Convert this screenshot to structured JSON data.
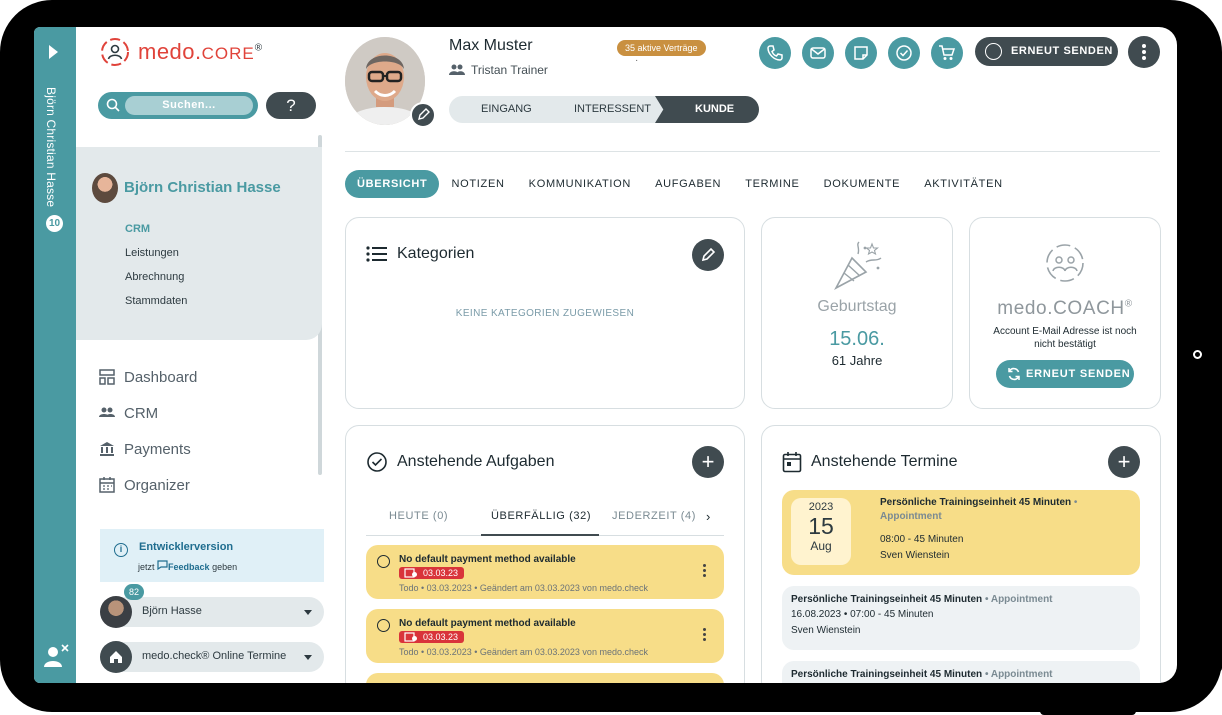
{
  "colors": {
    "accent": "#4a9aa2",
    "dark": "#404b50",
    "brand_red": "#e0433a",
    "warning": "#f7dd88",
    "danger": "#d9343a",
    "contracts": "#c99040"
  },
  "strip": {
    "client_name": "Björn Christian Hasse",
    "badge": "10"
  },
  "sidebar": {
    "logo_main": "medo.",
    "logo_suffix": "CORE",
    "logo_reg": "®",
    "search_placeholder": "Suchen...",
    "help_label": "?",
    "client": {
      "name": "Björn Christian Hasse",
      "menu": [
        "CRM",
        "Leistungen",
        "Abrechnung",
        "Stammdaten"
      ]
    },
    "nav": [
      {
        "label": "Dashboard",
        "icon": "dashboard-icon"
      },
      {
        "label": "CRM",
        "icon": "users-icon"
      },
      {
        "label": "Payments",
        "icon": "bank-icon"
      },
      {
        "label": "Organizer",
        "icon": "calendar-icon"
      }
    ],
    "dev_box": {
      "title": "Entwicklerversion",
      "pre": "jetzt",
      "link": "Feedback",
      "post": "geben"
    },
    "user": {
      "name": "Björn Hasse",
      "badge": "82"
    },
    "location": {
      "name": "medo.check® Online Termine"
    }
  },
  "header": {
    "name": "Max Muster",
    "trainer": "Tristan Trainer",
    "contracts_badge": "35 aktive Verträge",
    "dot": "·",
    "stages": [
      "EINGANG",
      "INTERESSENT",
      "KUNDE"
    ],
    "resend_label": "ERNEUT SENDEN",
    "actions": [
      "phone-icon",
      "mail-icon",
      "note-icon",
      "check-icon",
      "cart-icon"
    ]
  },
  "tabs": [
    "ÜBERSICHT",
    "NOTIZEN",
    "KOMMUNIKATION",
    "AUFGABEN",
    "TERMINE",
    "DOKUMENTE",
    "AKTIVITÄTEN"
  ],
  "categories": {
    "title": "Kategorien",
    "empty": "KEINE KATEGORIEN ZUGEWIESEN"
  },
  "birthday": {
    "label": "Geburtstag",
    "date": "15.06.",
    "age": "61 Jahre"
  },
  "coach": {
    "logo_main": "medo.",
    "logo_suffix": "COACH",
    "logo_reg": "®",
    "text": "Account E-Mail Adresse ist noch nicht bestätigt",
    "button": "ERNEUT SENDEN"
  },
  "tasks": {
    "title": "Anstehende Aufgaben",
    "tabs": [
      "HEUTE (0)",
      "ÜBERFÄLLIG (32)",
      "JEDERZEIT (4)"
    ],
    "items": [
      {
        "title": "No default payment method available",
        "due": "03.03.23",
        "meta": "Todo • 03.03.2023 • Geändert am 03.03.2023 von medo.check"
      },
      {
        "title": "No default payment method available",
        "due": "03.03.23",
        "meta": "Todo • 03.03.2023 • Geändert am 03.03.2023 von medo.check"
      }
    ]
  },
  "appointments": {
    "title": "Anstehende Termine",
    "featured": {
      "year": "2023",
      "day": "15",
      "month": "Aug",
      "title": "Persönliche Trainingseinheit 45 Minuten",
      "sep": " •",
      "type": "Appointment",
      "time": "08:00 - 45 Minuten",
      "person": "Sven Wienstein"
    },
    "items": [
      {
        "title": "Persönliche Trainingseinheit 45 Minuten",
        "type": "• Appointment",
        "line2": "16.08.2023 • 07:00 - 45 Minuten",
        "line3": "Sven Wienstein"
      },
      {
        "title": "Persönliche Trainingseinheit 45 Minuten",
        "type": "• Appointment",
        "line2": "",
        "line3": ""
      }
    ]
  }
}
